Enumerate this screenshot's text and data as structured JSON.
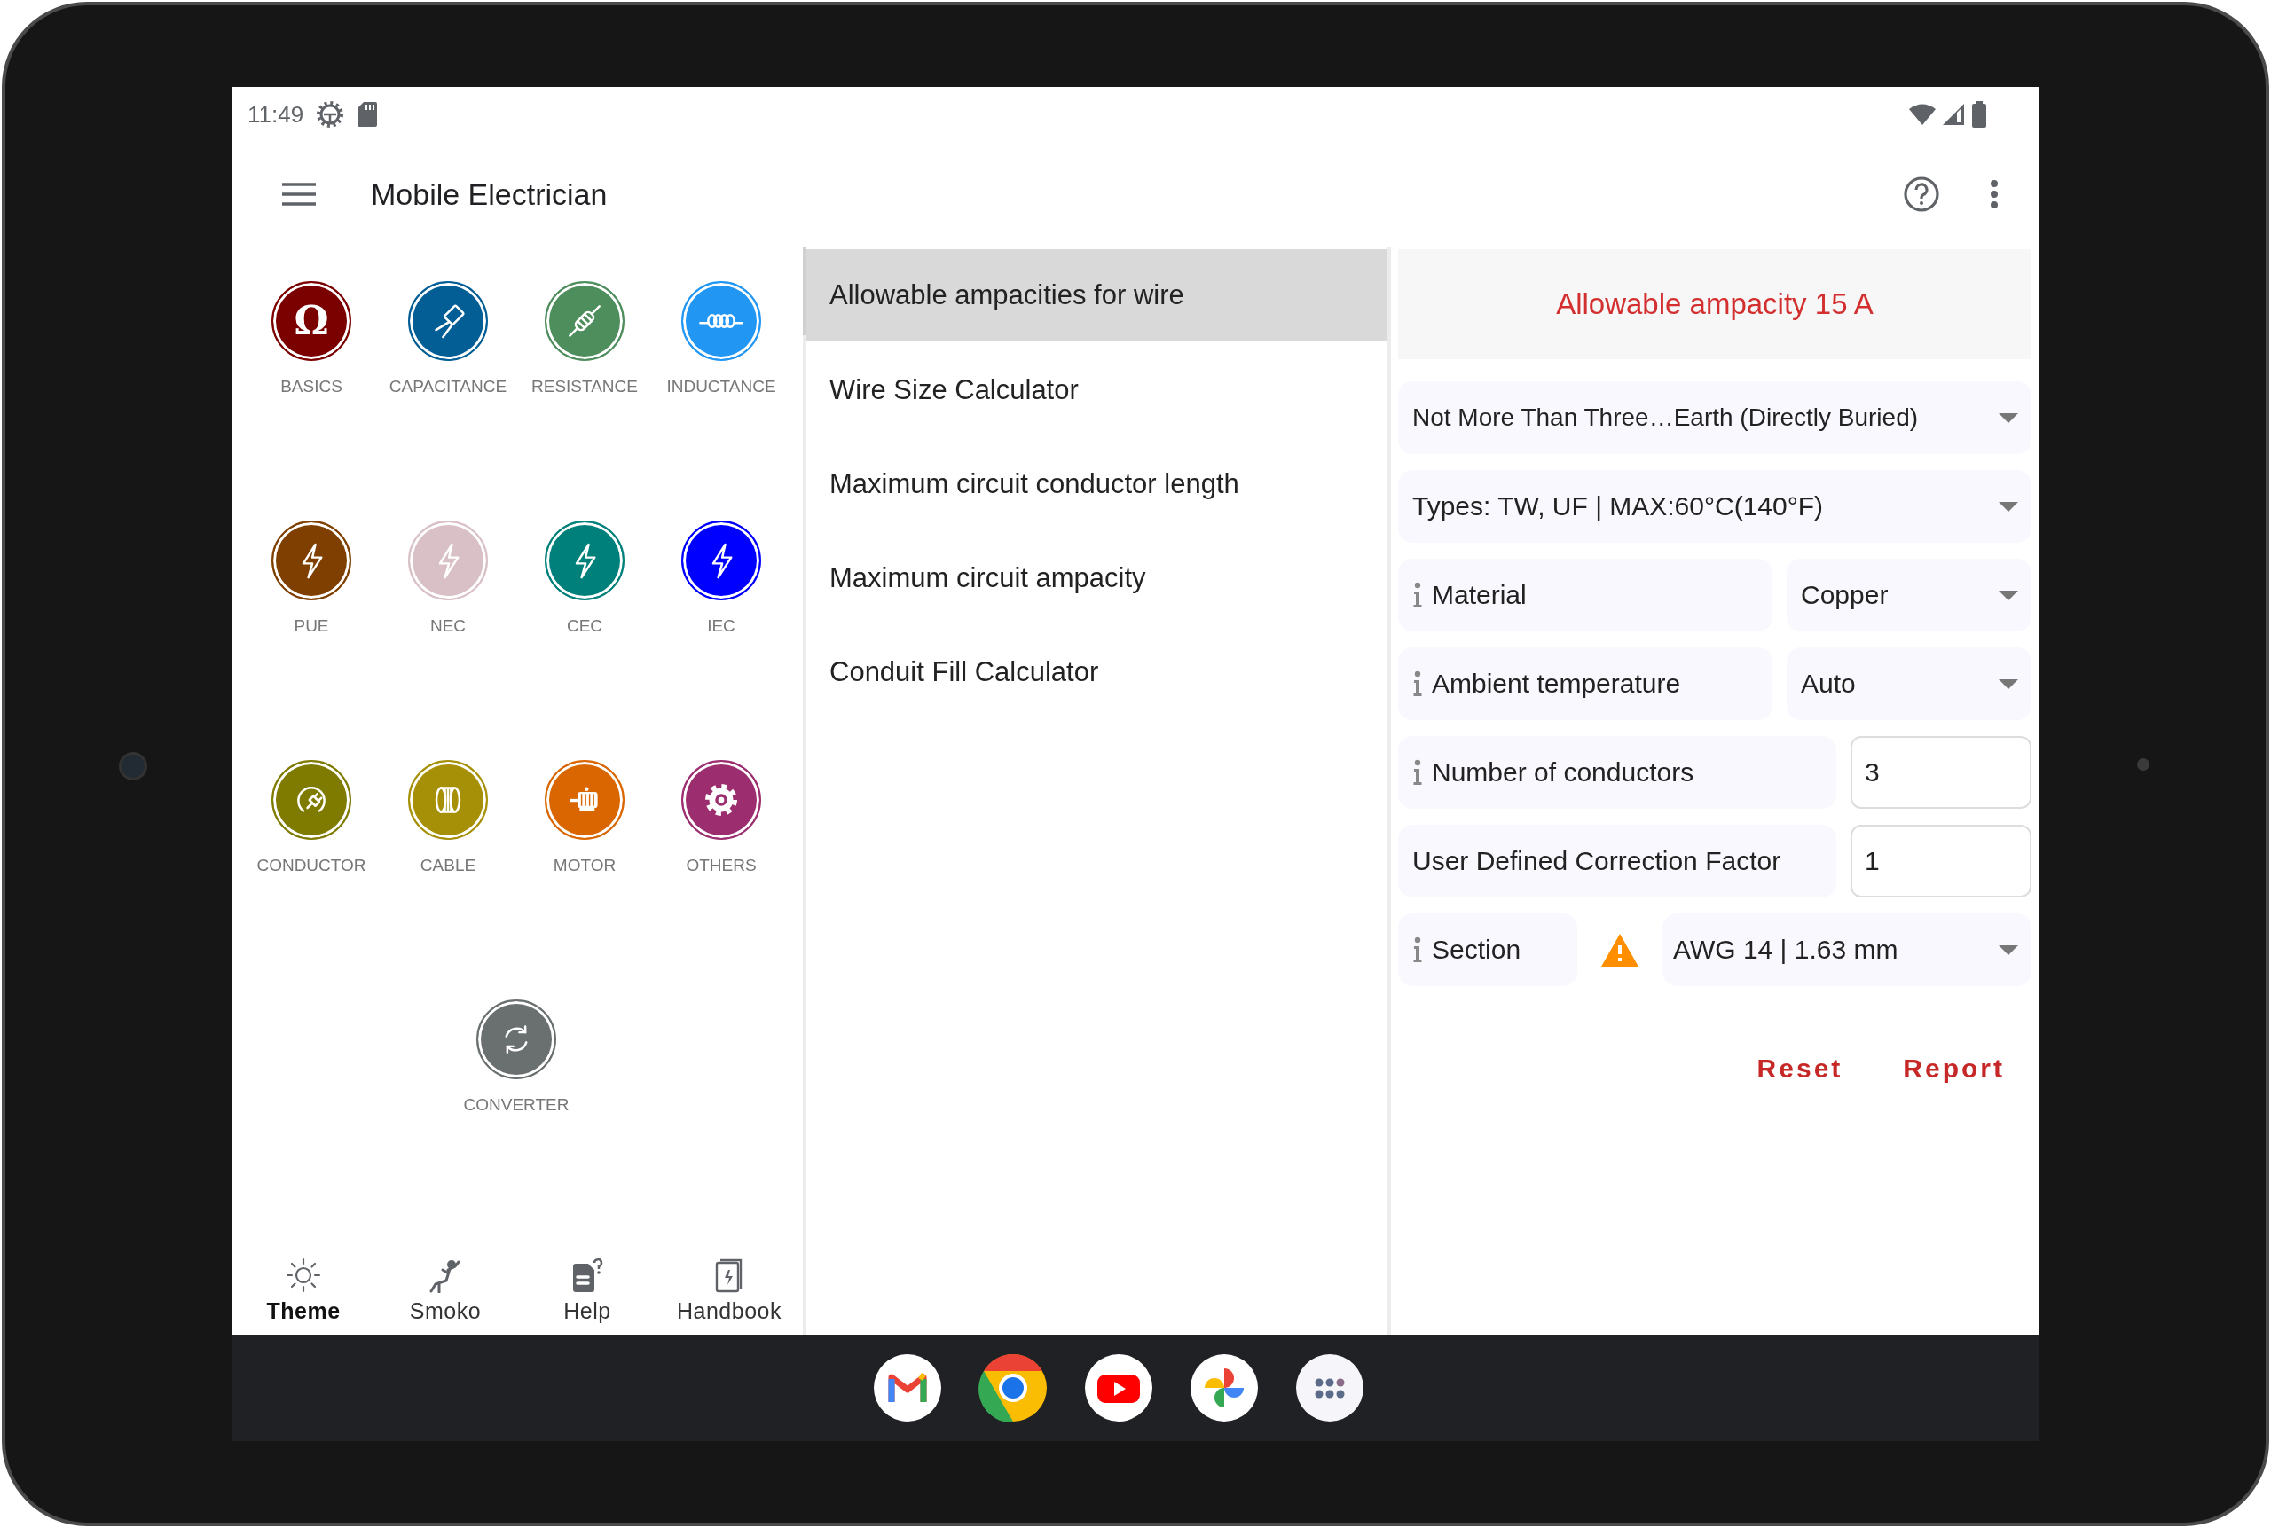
{
  "status_bar": {
    "time": "11:49"
  },
  "app_bar": {
    "title": "Mobile Electrician"
  },
  "categories": [
    {
      "label": "BASICS",
      "kind": "symbol",
      "glyph": "Ω",
      "color": "#7b0000"
    },
    {
      "label": "CAPACITANCE",
      "kind": "capacitor",
      "color": "#045e96"
    },
    {
      "label": "RESISTANCE",
      "kind": "resistor",
      "color": "#4e8d5c"
    },
    {
      "label": "INDUCTANCE",
      "kind": "coil",
      "color": "#2196f3"
    },
    {
      "label": "PUE",
      "kind": "bolt",
      "color": "#7f3f00"
    },
    {
      "label": "NEC",
      "kind": "bolt",
      "color": "#d8c0c6"
    },
    {
      "label": "CEC",
      "kind": "bolt",
      "color": "#00807a"
    },
    {
      "label": "IEC",
      "kind": "bolt",
      "color": "#0000ff"
    },
    {
      "label": "CONDUCTOR",
      "kind": "plug",
      "color": "#7f7a00"
    },
    {
      "label": "CABLE",
      "kind": "reel",
      "color": "#a69008"
    },
    {
      "label": "MOTOR",
      "kind": "motor",
      "color": "#d96600"
    },
    {
      "label": "OTHERS",
      "kind": "gear",
      "color": "#9c2e6f"
    },
    {
      "label": "CONVERTER",
      "kind": "cycle",
      "color": "#6a7070"
    }
  ],
  "bottom_nav": [
    {
      "label": "Theme",
      "kind": "sun",
      "selected": true
    },
    {
      "label": "Smoko",
      "kind": "lounger",
      "selected": false
    },
    {
      "label": "Help",
      "kind": "document",
      "selected": false
    },
    {
      "label": "Handbook",
      "kind": "book",
      "selected": false
    }
  ],
  "calculators": [
    {
      "label": "Allowable ampacities for wire",
      "selected": true
    },
    {
      "label": "Wire Size Calculator",
      "selected": false
    },
    {
      "label": "Maximum circuit conductor length",
      "selected": false
    },
    {
      "label": "Maximum circuit ampacity",
      "selected": false
    },
    {
      "label": "Conduit Fill Calculator",
      "selected": false
    }
  ],
  "result": {
    "text": "Allowable ampacity 15 A"
  },
  "form_rows": [
    {
      "kind": "dropdown",
      "value": "Not More Than Three…Earth (Directly Buried)"
    },
    {
      "kind": "dropdown",
      "value": "Types: TW, UF | MAX:60°C(140°F)"
    },
    {
      "kind": "select",
      "label": "Material",
      "info": true,
      "warning": false,
      "value": "Copper"
    },
    {
      "kind": "select",
      "label": "Ambient temperature",
      "info": true,
      "warning": false,
      "value": "Auto"
    },
    {
      "kind": "input",
      "label": "Number of conductors",
      "info": true,
      "value": "3"
    },
    {
      "kind": "input",
      "label": "User Defined Correction Factor",
      "info": false,
      "value": "1"
    },
    {
      "kind": "select",
      "label": "Section",
      "info": true,
      "warning": true,
      "value": "AWG 14 | 1.63 mm"
    }
  ],
  "actions": [
    "Reset",
    "Report"
  ]
}
